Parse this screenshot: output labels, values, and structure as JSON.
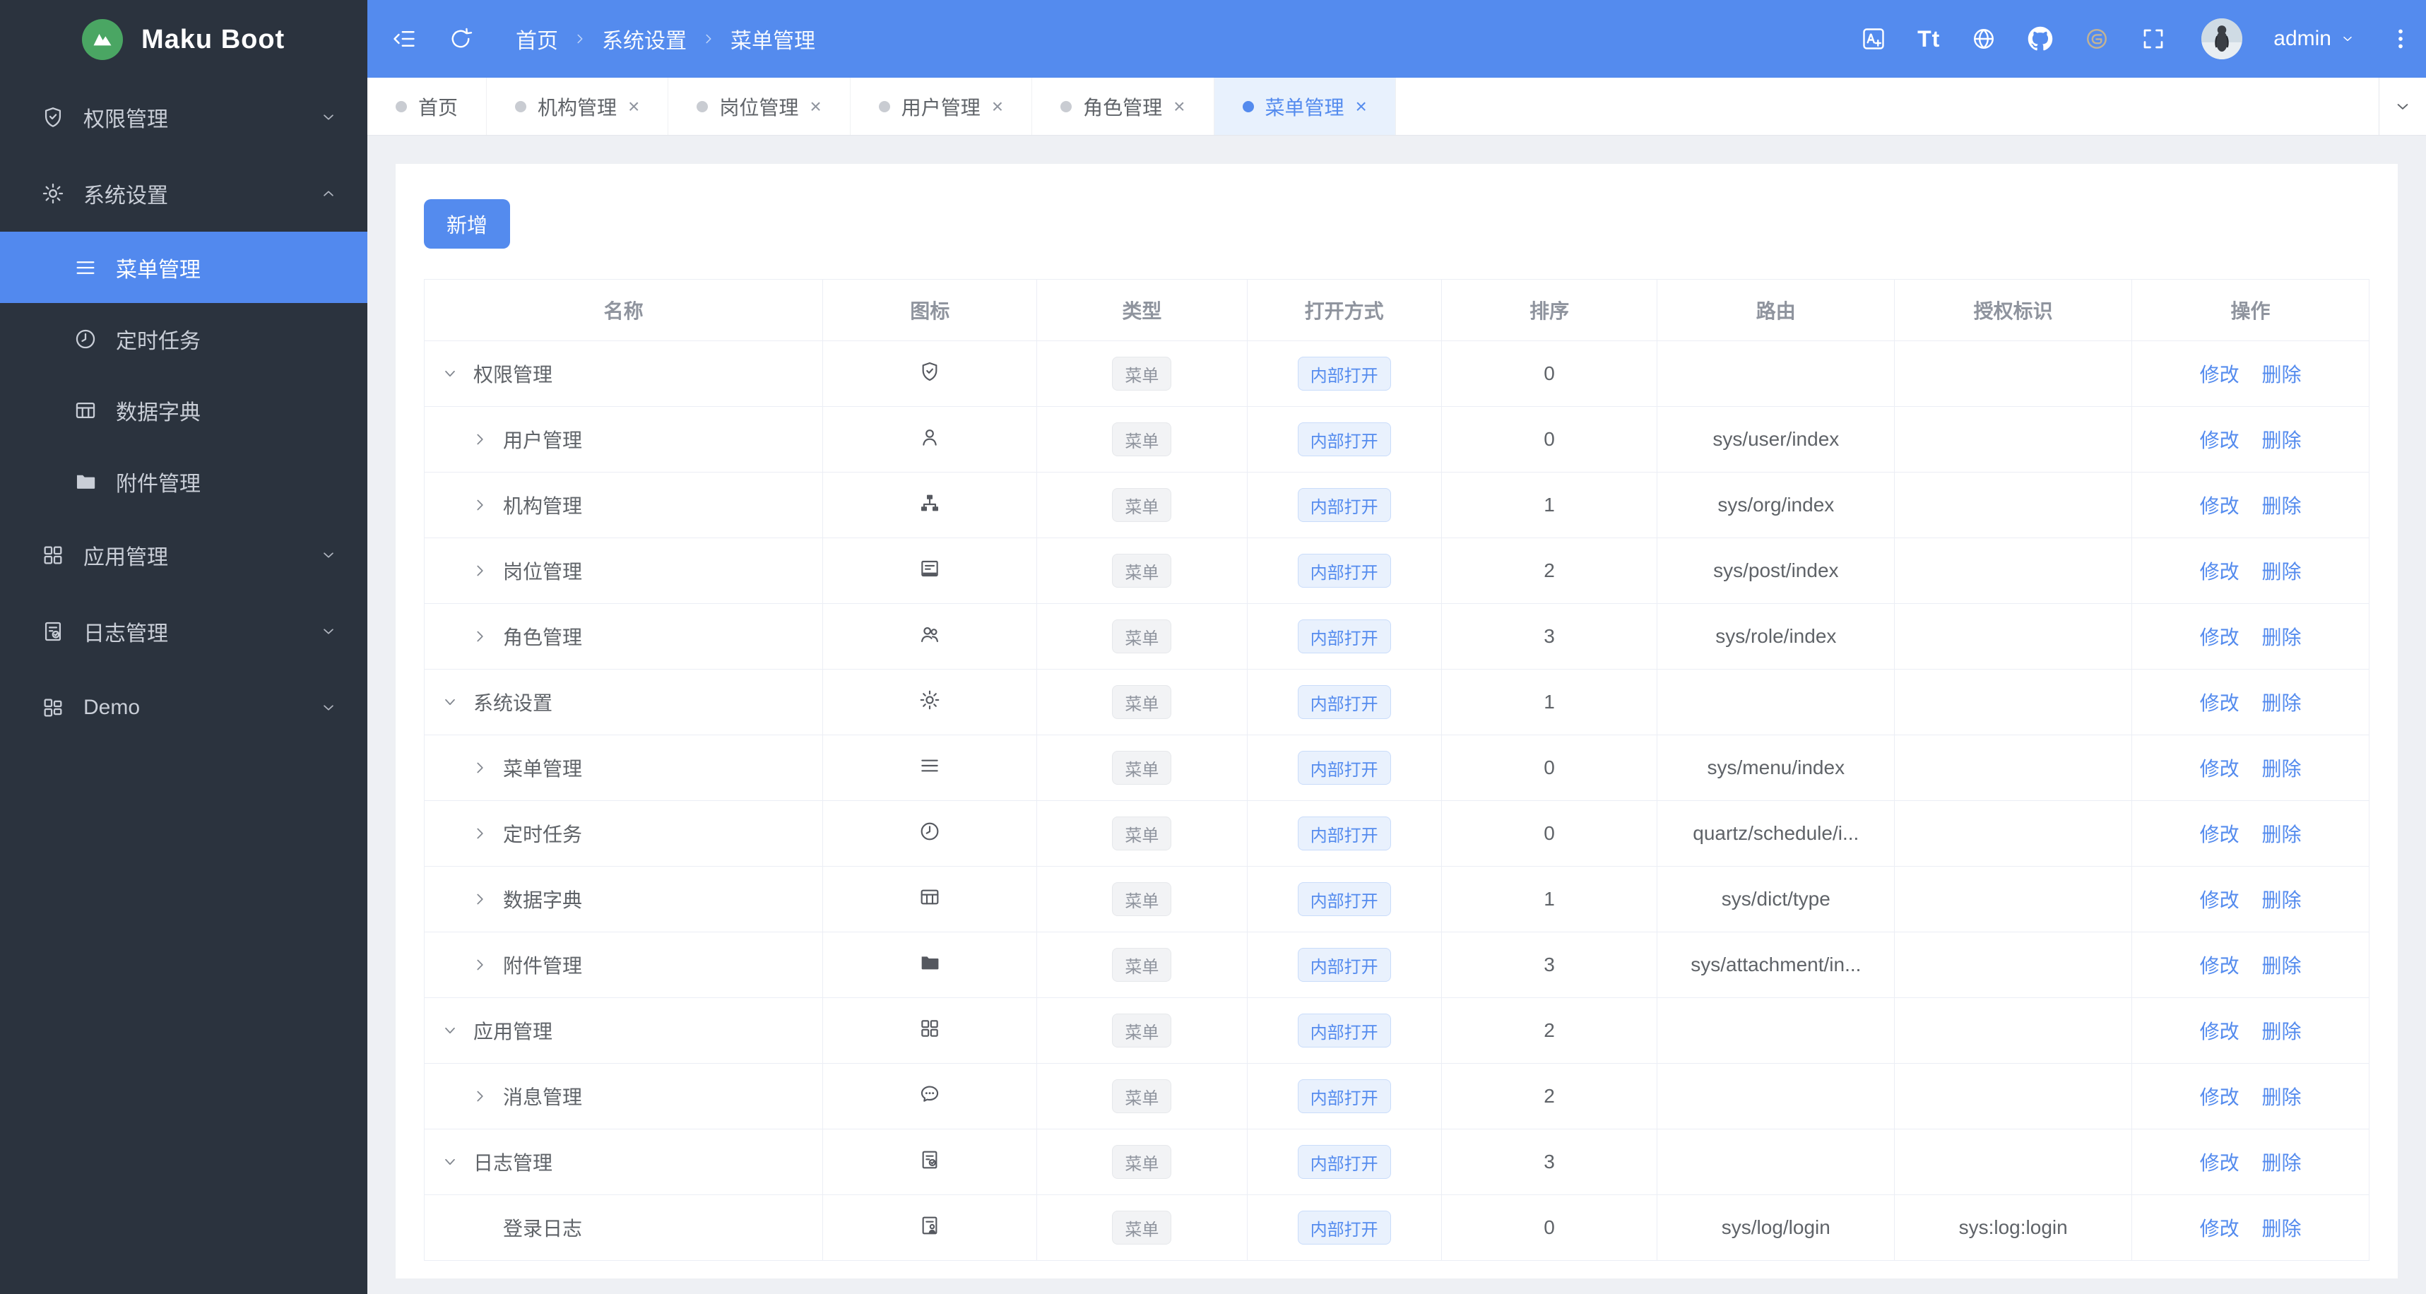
{
  "brand": {
    "name": "Maku Boot",
    "logo_color": "#4aa663"
  },
  "colors": {
    "accent_blue": "#548bee",
    "sidebar_bg": "#2b333e",
    "active_item_bg": "#5289ee",
    "tag_gray_bg": "#f2f3f5",
    "tag_blue_bg": "#e9f1fd",
    "page_bg": "#eef0f4"
  },
  "header": {
    "left_icons": [
      "collapse",
      "refresh"
    ],
    "breadcrumb": [
      "首页",
      "系统设置",
      "菜单管理"
    ],
    "tools": [
      "translate",
      "font-size",
      "globe",
      "github",
      "gitee",
      "fullscreen"
    ],
    "user": "admin"
  },
  "sidebar": {
    "items": [
      {
        "key": "permission-mgmt",
        "label": "权限管理",
        "icon": "shield-check",
        "state": "collapsed"
      },
      {
        "key": "system-settings",
        "label": "系统设置",
        "icon": "gear",
        "state": "expanded",
        "children": [
          {
            "key": "menu-mgmt",
            "label": "菜单管理",
            "icon": "menu-lines",
            "active": true
          },
          {
            "key": "scheduled-tasks",
            "label": "定时任务",
            "icon": "clock"
          },
          {
            "key": "data-dictionary",
            "label": "数据字典",
            "icon": "table-grid"
          },
          {
            "key": "attachment-mgmt",
            "label": "附件管理",
            "icon": "folder"
          }
        ]
      },
      {
        "key": "app-mgmt",
        "label": "应用管理",
        "icon": "app-grid",
        "state": "collapsed"
      },
      {
        "key": "log-mgmt",
        "label": "日志管理",
        "icon": "doc-check",
        "state": "collapsed"
      },
      {
        "key": "demo",
        "label": "Demo",
        "icon": "app-grid-2",
        "state": "collapsed"
      }
    ]
  },
  "tabs": {
    "close_glyph": "×",
    "items": [
      {
        "key": "home",
        "label": "首页",
        "closable": false,
        "active": false
      },
      {
        "key": "org-mgmt",
        "label": "机构管理",
        "closable": true,
        "active": false
      },
      {
        "key": "post-mgmt",
        "label": "岗位管理",
        "closable": true,
        "active": false
      },
      {
        "key": "user-mgmt",
        "label": "用户管理",
        "closable": true,
        "active": false
      },
      {
        "key": "role-mgmt",
        "label": "角色管理",
        "closable": true,
        "active": false
      },
      {
        "key": "menu-mgmt",
        "label": "菜单管理",
        "closable": true,
        "active": true
      }
    ]
  },
  "toolbar": {
    "add_label": "新增"
  },
  "table": {
    "columns": [
      "名称",
      "图标",
      "类型",
      "打开方式",
      "排序",
      "路由",
      "授权标识",
      "操作"
    ],
    "actions": [
      "修改",
      "删除"
    ],
    "rows": [
      {
        "name": "权限管理",
        "level": 1,
        "expanded": true,
        "icon": "shield-check",
        "type": "菜单",
        "open": "内部打开",
        "sort": "0",
        "route": "",
        "perm": ""
      },
      {
        "name": "用户管理",
        "level": 2,
        "expanded": false,
        "icon": "user",
        "type": "菜单",
        "open": "内部打开",
        "sort": "0",
        "route": "sys/user/index",
        "perm": ""
      },
      {
        "name": "机构管理",
        "level": 2,
        "expanded": false,
        "icon": "org",
        "type": "菜单",
        "open": "内部打开",
        "sort": "1",
        "route": "sys/org/index",
        "perm": ""
      },
      {
        "name": "岗位管理",
        "level": 2,
        "expanded": false,
        "icon": "badge",
        "type": "菜单",
        "open": "内部打开",
        "sort": "2",
        "route": "sys/post/index",
        "perm": ""
      },
      {
        "name": "角色管理",
        "level": 2,
        "expanded": false,
        "icon": "users",
        "type": "菜单",
        "open": "内部打开",
        "sort": "3",
        "route": "sys/role/index",
        "perm": ""
      },
      {
        "name": "系统设置",
        "level": 1,
        "expanded": true,
        "icon": "gear",
        "type": "菜单",
        "open": "内部打开",
        "sort": "1",
        "route": "",
        "perm": ""
      },
      {
        "name": "菜单管理",
        "level": 2,
        "expanded": false,
        "icon": "menu-lines",
        "type": "菜单",
        "open": "内部打开",
        "sort": "0",
        "route": "sys/menu/index",
        "perm": ""
      },
      {
        "name": "定时任务",
        "level": 2,
        "expanded": false,
        "icon": "clock",
        "type": "菜单",
        "open": "内部打开",
        "sort": "0",
        "route": "quartz/schedule/i...",
        "perm": ""
      },
      {
        "name": "数据字典",
        "level": 2,
        "expanded": false,
        "icon": "table-grid",
        "type": "菜单",
        "open": "内部打开",
        "sort": "1",
        "route": "sys/dict/type",
        "perm": ""
      },
      {
        "name": "附件管理",
        "level": 2,
        "expanded": false,
        "icon": "folder",
        "type": "菜单",
        "open": "内部打开",
        "sort": "3",
        "route": "sys/attachment/in...",
        "perm": ""
      },
      {
        "name": "应用管理",
        "level": 1,
        "expanded": true,
        "icon": "app-grid",
        "type": "菜单",
        "open": "内部打开",
        "sort": "2",
        "route": "",
        "perm": ""
      },
      {
        "name": "消息管理",
        "level": 2,
        "expanded": false,
        "icon": "chat",
        "type": "菜单",
        "open": "内部打开",
        "sort": "2",
        "route": "",
        "perm": ""
      },
      {
        "name": "日志管理",
        "level": 1,
        "expanded": true,
        "icon": "doc-check",
        "type": "菜单",
        "open": "内部打开",
        "sort": "3",
        "route": "",
        "perm": ""
      },
      {
        "name": "登录日志",
        "level": 2,
        "expanded": null,
        "icon": "doc-user",
        "type": "菜单",
        "open": "内部打开",
        "sort": "0",
        "route": "sys/log/login",
        "perm": "sys:log:login"
      }
    ]
  }
}
